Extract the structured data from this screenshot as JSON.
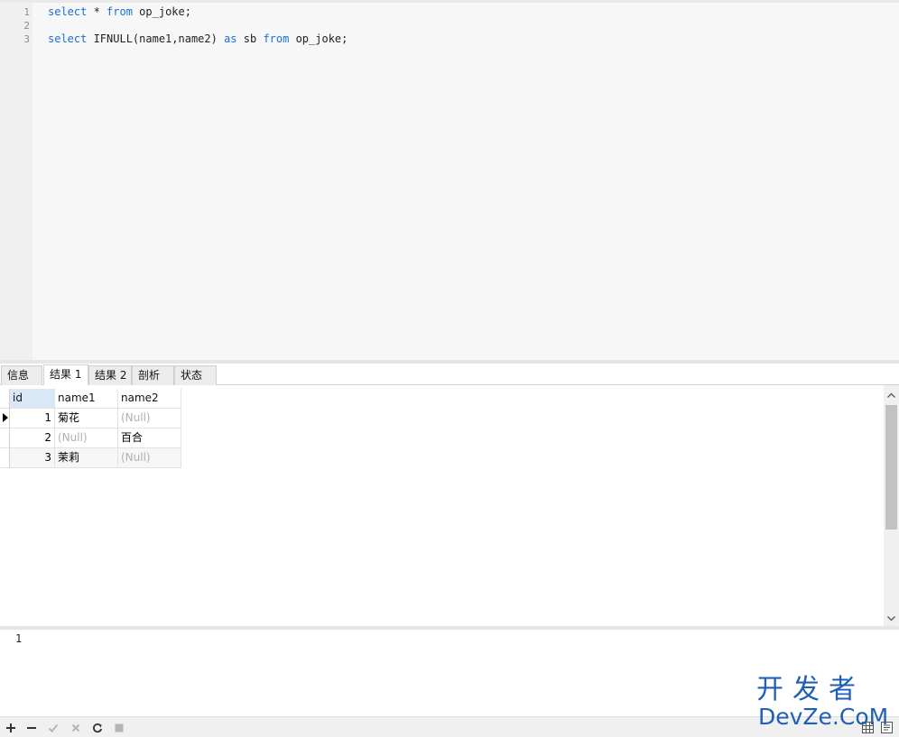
{
  "editor": {
    "lines": [
      {
        "no": "1",
        "tokens": [
          {
            "t": "select",
            "kw": true
          },
          {
            "t": " * "
          },
          {
            "t": "from",
            "kw": true
          },
          {
            "t": " op_joke;"
          }
        ]
      },
      {
        "no": "2",
        "tokens": []
      },
      {
        "no": "3",
        "tokens": [
          {
            "t": "select",
            "kw": true
          },
          {
            "t": " IFNULL(name1,name2) "
          },
          {
            "t": "as",
            "kw": true
          },
          {
            "t": " sb "
          },
          {
            "t": "from",
            "kw": true
          },
          {
            "t": " op_joke;"
          }
        ]
      }
    ]
  },
  "tabs": [
    {
      "label": "信息",
      "active": false
    },
    {
      "label": "结果 1",
      "active": true
    },
    {
      "label": "结果 2",
      "active": false
    },
    {
      "label": "剖析",
      "active": false
    },
    {
      "label": "状态",
      "active": false
    }
  ],
  "grid": {
    "columns": [
      "id",
      "name1",
      "name2"
    ],
    "rows": [
      {
        "id": "1",
        "name1": "菊花",
        "name2": "(Null)"
      },
      {
        "id": "2",
        "name1": "(Null)",
        "name2": "百合"
      },
      {
        "id": "3",
        "name1": "茉莉",
        "name2": "(Null)"
      }
    ]
  },
  "log": {
    "text": "1"
  },
  "toolbar": {
    "buttons": [
      "plus-icon",
      "minus-icon",
      "check-icon",
      "cross-icon",
      "refresh-icon",
      "stop-icon"
    ]
  },
  "watermark": {
    "line1": "开发者",
    "line2": "DevZe.CoM"
  },
  "colors": {
    "keyword": "#1a6fd6",
    "null_text": "#b0b0b0",
    "selected_header": "#d9e8f7",
    "watermark": "#1f5fb6"
  }
}
